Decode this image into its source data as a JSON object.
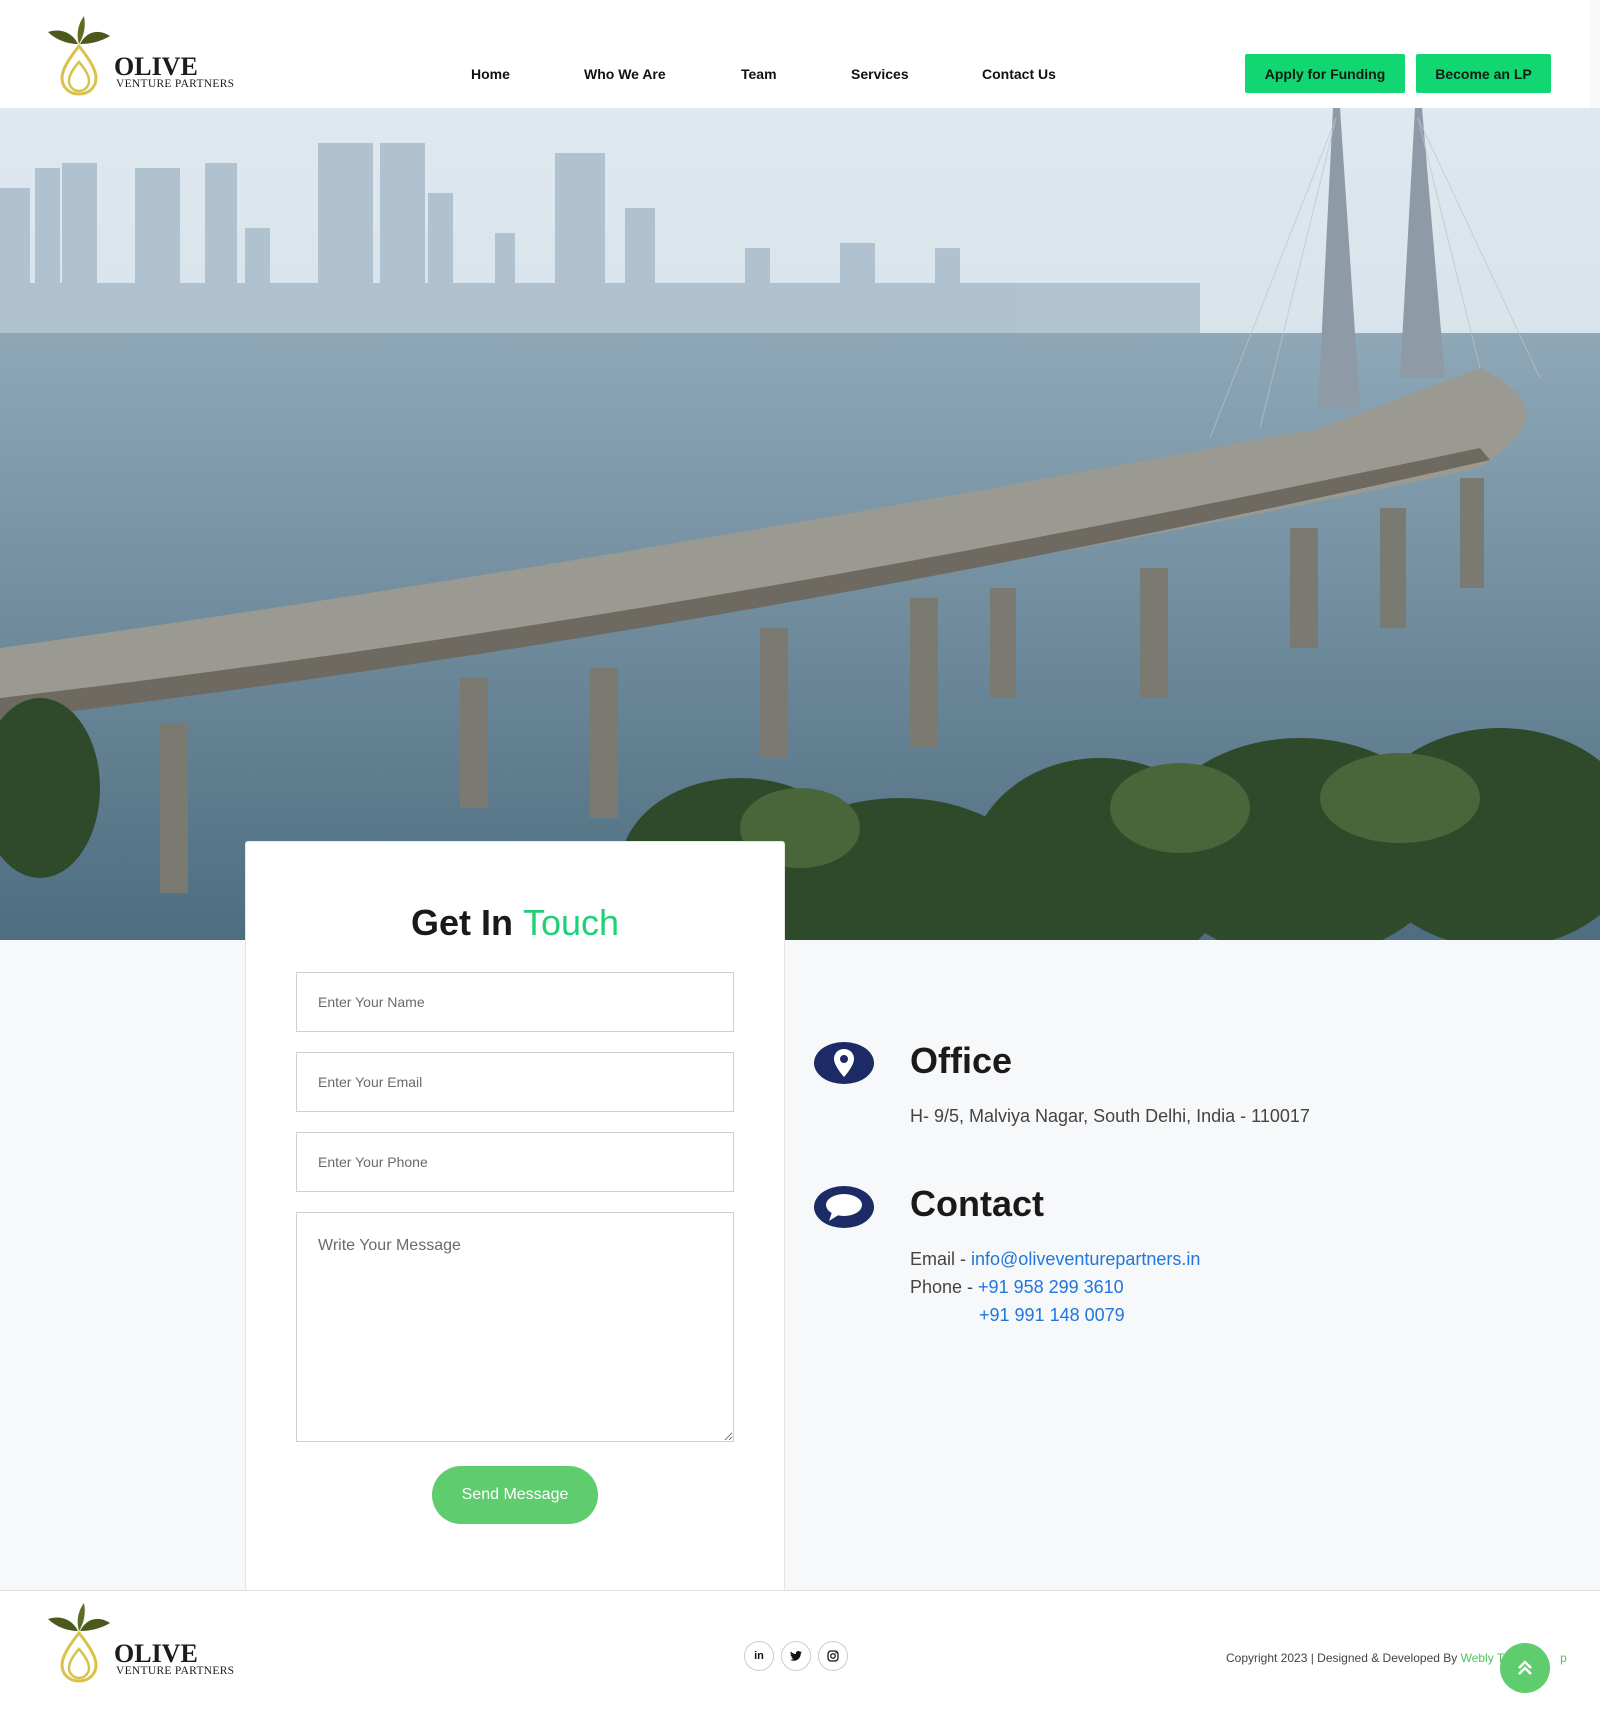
{
  "brand": {
    "name": "OLIVE",
    "tagline": "VENTURE PARTNERS"
  },
  "nav": {
    "items": [
      {
        "label": "Home"
      },
      {
        "label": "Who We Are"
      },
      {
        "label": "Team"
      },
      {
        "label": "Services"
      },
      {
        "label": "Contact Us"
      }
    ],
    "cta_primary": "Apply for Funding",
    "cta_secondary": "Become an LP"
  },
  "hero": {
    "image": "bandra-worli-sea-link-photo"
  },
  "form": {
    "title_main": "Get In",
    "title_accent": "Touch",
    "name_placeholder": "Enter Your Name",
    "email_placeholder": "Enter Your Email",
    "phone_placeholder": "Enter Your Phone",
    "message_placeholder": "Write Your Message",
    "submit_label": "Send Message"
  },
  "office": {
    "icon": "map-pin-icon",
    "title": "Office",
    "address": "H- 9/5, Malviya Nagar, South Delhi, India - 110017"
  },
  "contact": {
    "icon": "chat-bubble-icon",
    "title": "Contact",
    "email_label": "Email - ",
    "email": "info@oliveventurepartners.in",
    "phone_label": "Phone - ",
    "phone1": "+91 958 299 3610",
    "phone2": "+91 991 148 0079"
  },
  "footer": {
    "social": [
      {
        "icon": "linkedin-icon",
        "text": "in"
      },
      {
        "icon": "twitter-icon"
      },
      {
        "icon": "instagram-icon"
      }
    ],
    "copyright": "Copyright 2023 | Designed & Developed By ",
    "developer": "Webly T",
    "developer_tail": "p"
  },
  "colors": {
    "accent_green": "#12d672",
    "button_green": "#5fcc6d",
    "icon_navy": "#1c2a66",
    "link_blue": "#1f76e0"
  }
}
